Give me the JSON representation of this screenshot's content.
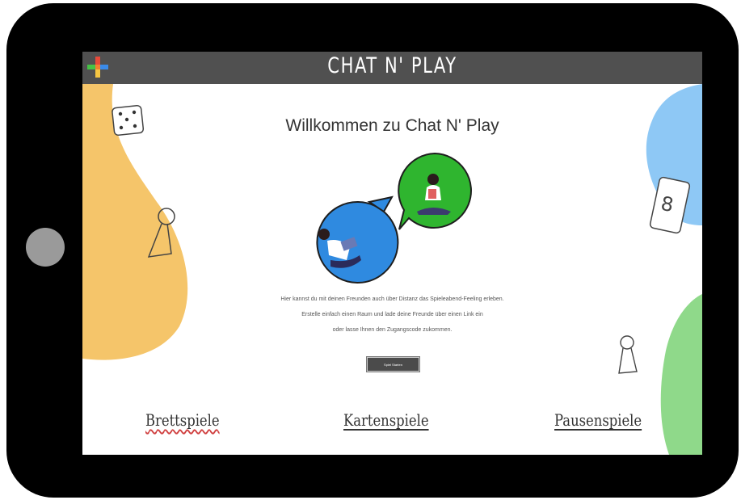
{
  "app": {
    "brand": "CHAT N' PLAY"
  },
  "main": {
    "welcome": "Willkommen zu Chat N' Play",
    "description_lines": [
      "Hier kannst du mit deinen Freunden auch über Distanz das Spieleabend-Feeling erleben.",
      "Erstelle einfach einen Raum und lade deine Freunde über einen Link ein",
      "oder lasse Ihnen den Zugangscode zukommen."
    ],
    "start_button": "Spiel Starten"
  },
  "categories": {
    "board": "Brettspiele",
    "cards": "Kartenspiele",
    "breaks": "Pausenspiele"
  },
  "decor": {
    "card_number": "8"
  },
  "colors": {
    "topbar": "#505050",
    "yellow_blob": "#f5c56a",
    "blue_blob": "#8ec8f5",
    "green_blob": "#8fd98a",
    "blue_bubble": "#2f8ae0",
    "green_bubble": "#2fb52f"
  }
}
